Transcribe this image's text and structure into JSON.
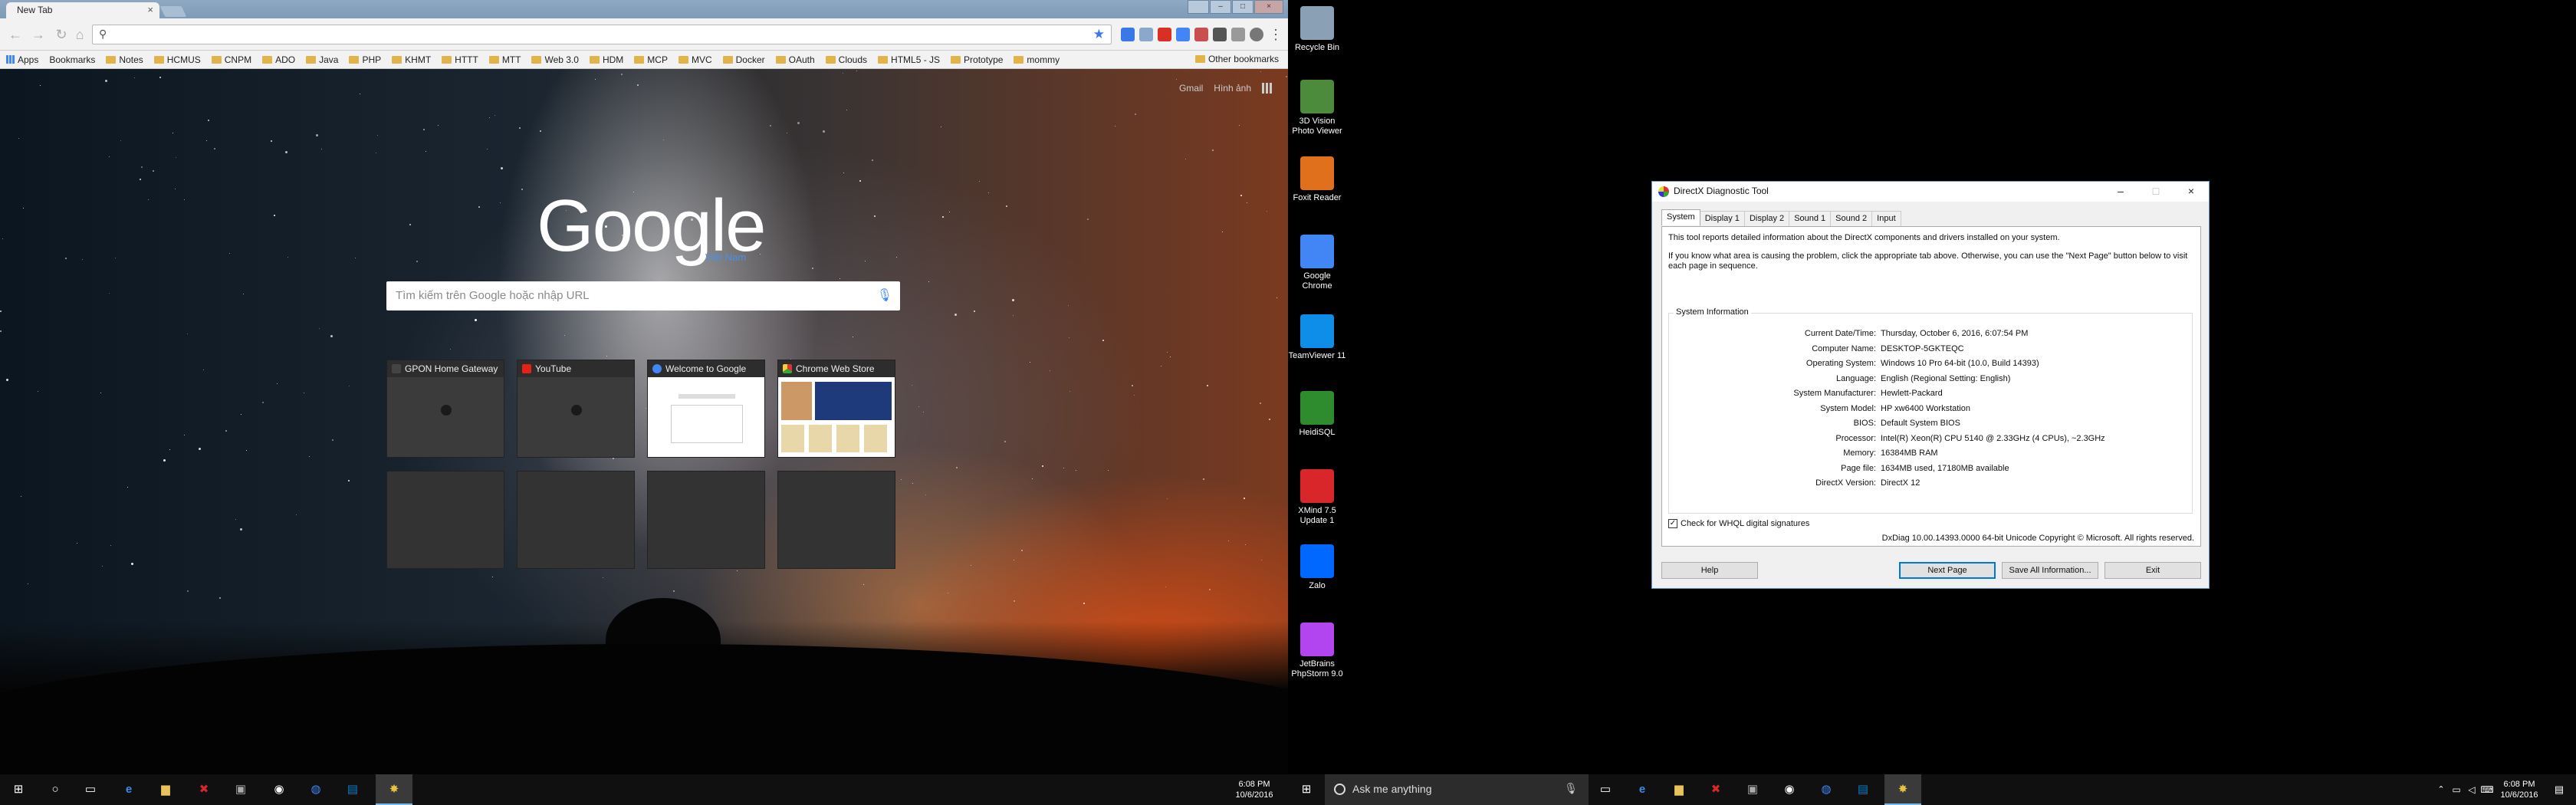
{
  "chrome": {
    "tab_title": "New Tab",
    "tab_close": "×",
    "omnibox_value": "",
    "bookmarks": [
      {
        "label": "Apps",
        "kind": "apps"
      },
      {
        "label": "Bookmarks",
        "kind": "page"
      },
      {
        "label": "Notes",
        "kind": "folder"
      },
      {
        "label": "HCMUS",
        "kind": "folder"
      },
      {
        "label": "CNPM",
        "kind": "folder"
      },
      {
        "label": "ADO",
        "kind": "folder"
      },
      {
        "label": "Java",
        "kind": "folder"
      },
      {
        "label": "PHP",
        "kind": "folder"
      },
      {
        "label": "KHMT",
        "kind": "folder"
      },
      {
        "label": "HTTT",
        "kind": "folder"
      },
      {
        "label": "MTT",
        "kind": "folder"
      },
      {
        "label": "Web 3.0",
        "kind": "folder"
      },
      {
        "label": "HDM",
        "kind": "folder"
      },
      {
        "label": "MCP",
        "kind": "folder"
      },
      {
        "label": "MVC",
        "kind": "folder"
      },
      {
        "label": "Docker",
        "kind": "folder"
      },
      {
        "label": "OAuth",
        "kind": "folder"
      },
      {
        "label": "Clouds",
        "kind": "folder"
      },
      {
        "label": "HTML5 - JS",
        "kind": "folder"
      },
      {
        "label": "Prototype",
        "kind": "folder"
      },
      {
        "label": "mommy",
        "kind": "folder"
      }
    ],
    "other_bookmarks": "Other bookmarks"
  },
  "ntp": {
    "top_links": [
      "Gmail",
      "Hình ảnh"
    ],
    "logo": "Google",
    "logo_sub": "Việt Nam",
    "search_placeholder": "Tìm kiếm trên Google hoặc nhập URL",
    "tiles": [
      {
        "title": "GPON Home Gateway",
        "favicon_color": "#444444",
        "kind": "blank"
      },
      {
        "title": "YouTube",
        "favicon_color": "#e62117",
        "kind": "blank"
      },
      {
        "title": "Welcome to Google",
        "favicon_color": "#4285f4",
        "kind": "page"
      },
      {
        "title": "Chrome Web Store",
        "favicon_color": "#4285f4",
        "kind": "store"
      }
    ]
  },
  "taskbar_left": {
    "time": "6:08 PM",
    "date": "10/6/2016"
  },
  "taskbar_right": {
    "search_placeholder": "Ask me anything",
    "time": "6:08 PM",
    "date": "10/6/2016"
  },
  "desktop_icons": [
    {
      "label": "Recycle Bin",
      "color": "#8aa0b4"
    },
    {
      "label": "3D Vision Photo Viewer",
      "color": "#4c8a3c"
    },
    {
      "label": "Foxit Reader",
      "color": "#e0701c"
    },
    {
      "label": "Google Chrome",
      "color": "#4285f4"
    },
    {
      "label": "TeamViewer 11",
      "color": "#0e8ee9"
    },
    {
      "label": "HeidiSQL",
      "color": "#2e8b2e"
    },
    {
      "label": "XMind 7.5 Update 1",
      "color": "#d8262b"
    },
    {
      "label": "Zalo",
      "color": "#0068ff"
    },
    {
      "label": "JetBrains PhpStorm 9.0",
      "color": "#b345f1"
    }
  ],
  "dxdiag": {
    "title": "DirectX Diagnostic Tool",
    "tabs": [
      "System",
      "Display 1",
      "Display 2",
      "Sound 1",
      "Sound 2",
      "Input"
    ],
    "intro1": "This tool reports detailed information about the DirectX components and drivers installed on your system.",
    "intro2": "If you know what area is causing the problem, click the appropriate tab above.  Otherwise, you can use the \"Next Page\" button below to visit each page in sequence.",
    "group_label": "System Information",
    "rows": [
      {
        "k": "Current Date/Time:",
        "v": "Thursday, October 6, 2016, 6:07:54 PM"
      },
      {
        "k": "Computer Name:",
        "v": "DESKTOP-5GKTEQC"
      },
      {
        "k": "Operating System:",
        "v": "Windows 10 Pro 64-bit (10.0, Build 14393)"
      },
      {
        "k": "Language:",
        "v": "English (Regional Setting: English)"
      },
      {
        "k": "System Manufacturer:",
        "v": "Hewlett-Packard"
      },
      {
        "k": "System Model:",
        "v": "HP xw6400 Workstation"
      },
      {
        "k": "BIOS:",
        "v": "Default System BIOS"
      },
      {
        "k": "Processor:",
        "v": "Intel(R) Xeon(R) CPU          5140  @ 2.33GHz (4 CPUs), ~2.3GHz"
      },
      {
        "k": "Memory:",
        "v": "16384MB RAM"
      },
      {
        "k": "Page file:",
        "v": "1634MB used, 17180MB available"
      },
      {
        "k": "DirectX Version:",
        "v": "DirectX 12"
      }
    ],
    "whql_label": "Check for WHQL digital signatures",
    "whql_checked": true,
    "footer": "DxDiag 10.00.14393.0000 64-bit Unicode  Copyright © Microsoft. All rights reserved.",
    "buttons": {
      "help": "Help",
      "next": "Next Page",
      "save": "Save All Information...",
      "exit": "Exit"
    }
  }
}
